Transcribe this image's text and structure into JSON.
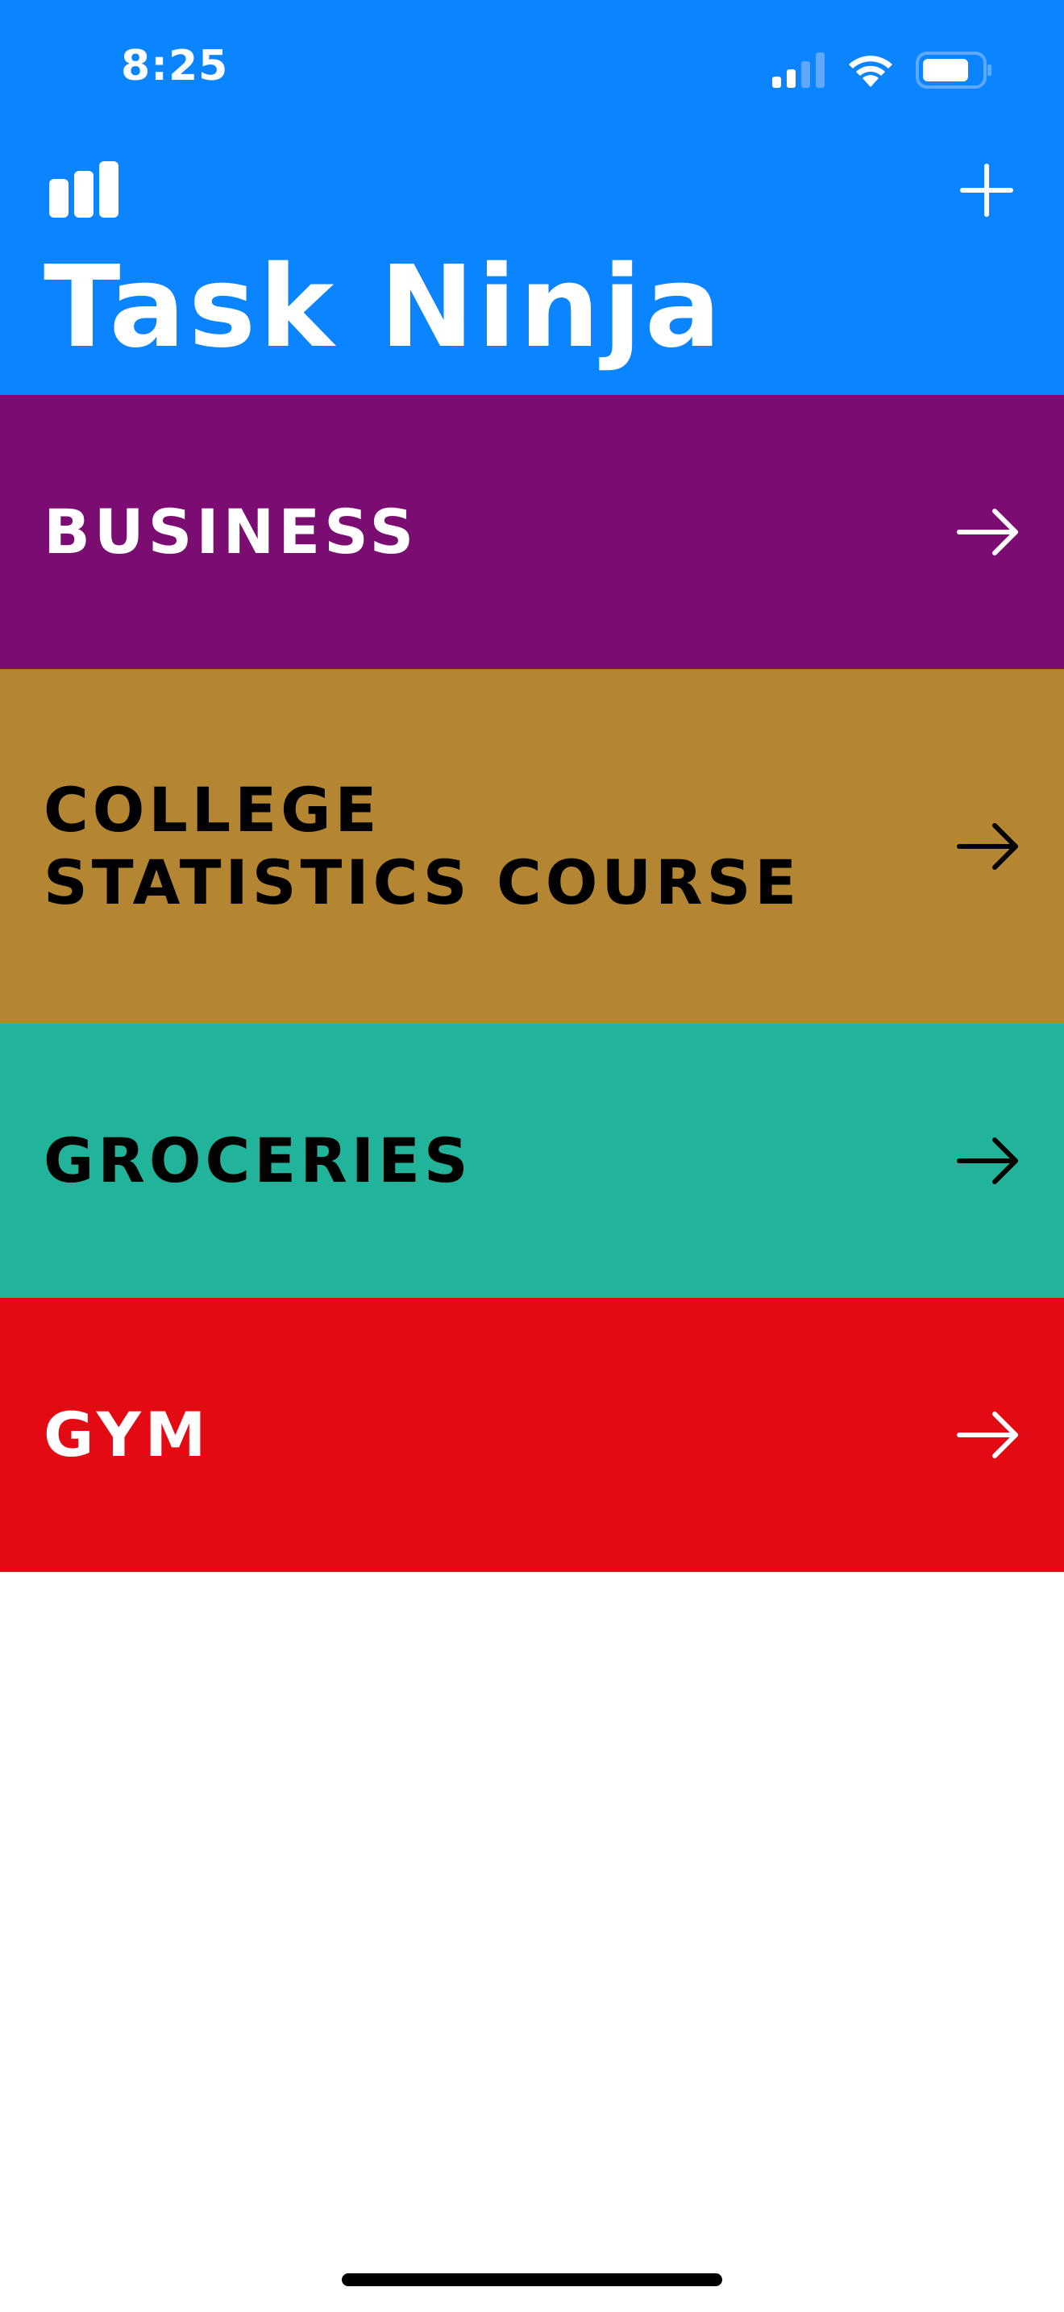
{
  "status_bar": {
    "time": "8:25",
    "icons": [
      "cellular-signal-icon",
      "wifi-icon",
      "battery-icon"
    ]
  },
  "header": {
    "title": "Task Ninja",
    "background_color": "#0a84ff",
    "left_icon": "bar-chart-icon",
    "right_icon": "plus-icon"
  },
  "lists": [
    {
      "label": "BUSINESS",
      "background_color": "#7b0c72",
      "text_color": "#ffffff",
      "icon": "arrow-right-icon"
    },
    {
      "label": "COLLEGE\nSTATISTICS COURSE",
      "background_color": "#b58632",
      "text_color": "#000000",
      "icon": "arrow-right-icon"
    },
    {
      "label": "GROCERIES",
      "background_color": "#22b49a",
      "text_color": "#000000",
      "icon": "arrow-right-icon"
    },
    {
      "label": "GYM",
      "background_color": "#e30a14",
      "text_color": "#ffffff",
      "icon": "arrow-right-icon"
    }
  ]
}
